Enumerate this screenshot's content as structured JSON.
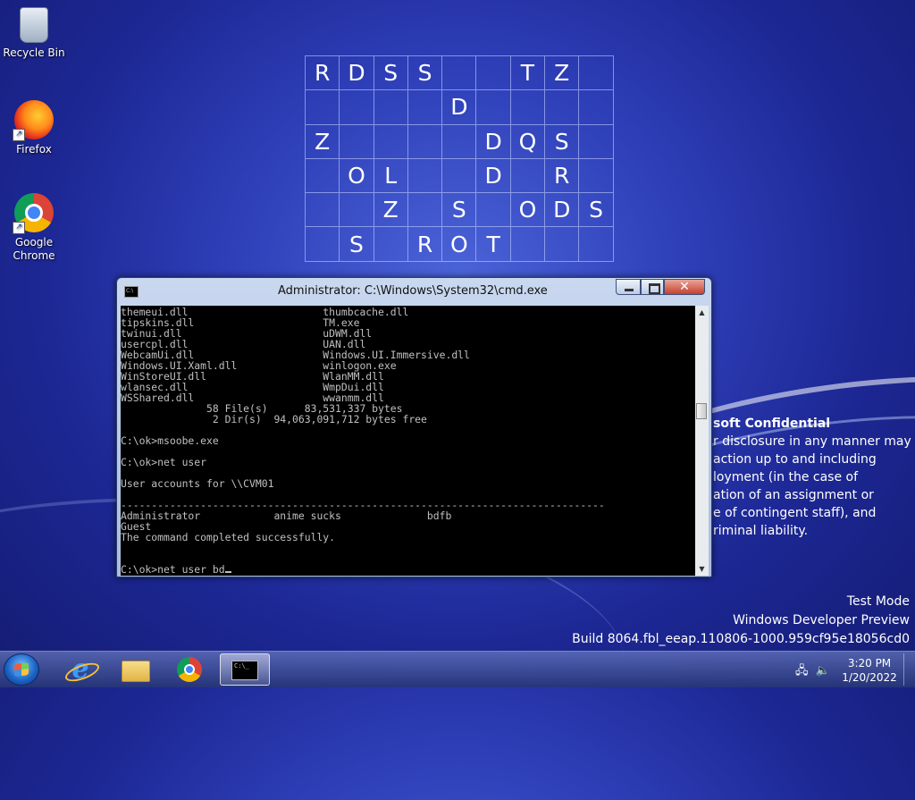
{
  "desktop_icons": [
    {
      "label": "Recycle Bin",
      "icon": "recycle-bin-icon"
    },
    {
      "label": "Firefox",
      "icon": "firefox-icon"
    },
    {
      "label": "Google Chrome",
      "icon": "chrome-icon"
    }
  ],
  "letter_grid": [
    [
      "R",
      "D",
      "S",
      "S",
      "",
      "",
      "T",
      "Z",
      ""
    ],
    [
      "",
      "",
      "",
      "",
      "D",
      "",
      "",
      "",
      ""
    ],
    [
      "Z",
      "",
      "",
      "",
      "",
      "D",
      "Q",
      "S",
      ""
    ],
    [
      "",
      "O",
      "L",
      "",
      "",
      "D",
      "",
      "R",
      ""
    ],
    [
      "",
      "",
      "Z",
      "",
      "S",
      "",
      "O",
      "D",
      "S"
    ],
    [
      "",
      "S",
      "",
      "R",
      "O",
      "T",
      "",
      "",
      ""
    ]
  ],
  "watermark": {
    "title": "soft Confidential",
    "lines": [
      "r disclosure in any manner may",
      "action up to and including",
      "loyment (in the case of",
      "ation of an assignment or",
      "e of contingent staff), and",
      "riminal liability."
    ]
  },
  "build_info": {
    "line1": "Test Mode",
    "line2": "Windows Developer Preview",
    "line3": "Build 8064.fbl_eeap.110806-1000.959cf95e18056cd0"
  },
  "cmd_window": {
    "title": "Administrator: C:\\Windows\\System32\\cmd.exe",
    "close_label": "✕",
    "console_lines": [
      "themeui.dll                      thumbcache.dll",
      "tipskins.dll                     TM.exe",
      "twinui.dll                       uDWM.dll",
      "usercpl.dll                      UAN.dll",
      "WebcamUi.dll                     Windows.UI.Immersive.dll",
      "Windows.UI.Xaml.dll              winlogon.exe",
      "WinStoreUI.dll                   WlanMM.dll",
      "wlansec.dll                      WmpDui.dll",
      "WSShared.dll                     wwanmm.dll",
      "              58 File(s)      83,531,337 bytes",
      "               2 Dir(s)  94,063,091,712 bytes free",
      "",
      "C:\\ok>msoobe.exe",
      "",
      "C:\\ok>net user",
      "",
      "User accounts for \\\\CVM01",
      "",
      "-------------------------------------------------------------------------------",
      "Administrator            anime sucks              bdfb",
      "Guest",
      "The command completed successfully.",
      "",
      ""
    ],
    "prompt_line": "C:\\ok>net user bd"
  },
  "taskbar": {
    "apps": [
      "internet-explorer",
      "file-explorer",
      "chrome",
      "command-prompt"
    ],
    "clock_time": "3:20 PM",
    "clock_date": "1/20/2022"
  }
}
